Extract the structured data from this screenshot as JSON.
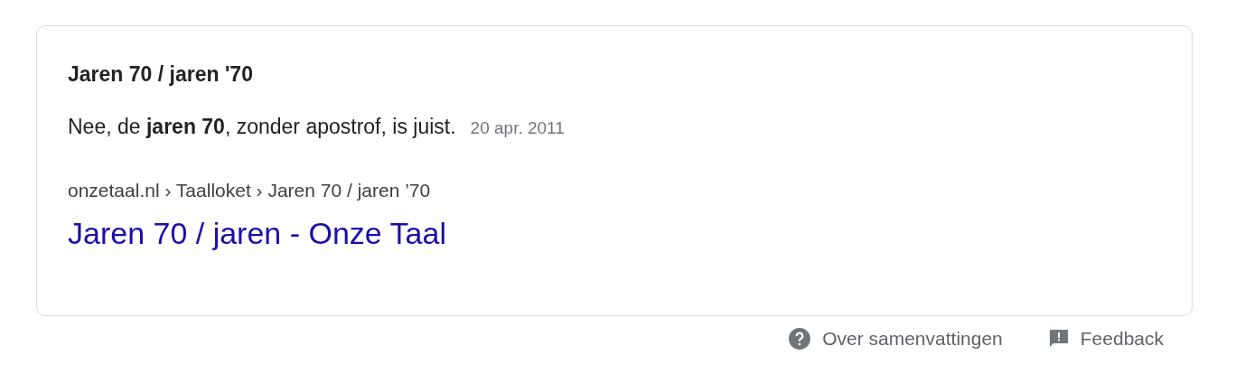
{
  "snippet": {
    "title": "Jaren 70 / jaren '70",
    "text": "Nee, de **jaren 70**, zonder apostrof, is juist.",
    "date": "20 apr. 2011",
    "breadcrumb": "onzetaal.nl › Taalloket › Jaren 70 / jaren ’70",
    "link": "Jaren 70 / jaren - Onze Taal"
  },
  "footer": [
    {
      "kind": "help",
      "label": "Over samenvattingen"
    },
    {
      "kind": "feedback",
      "label": "Feedback"
    }
  ]
}
